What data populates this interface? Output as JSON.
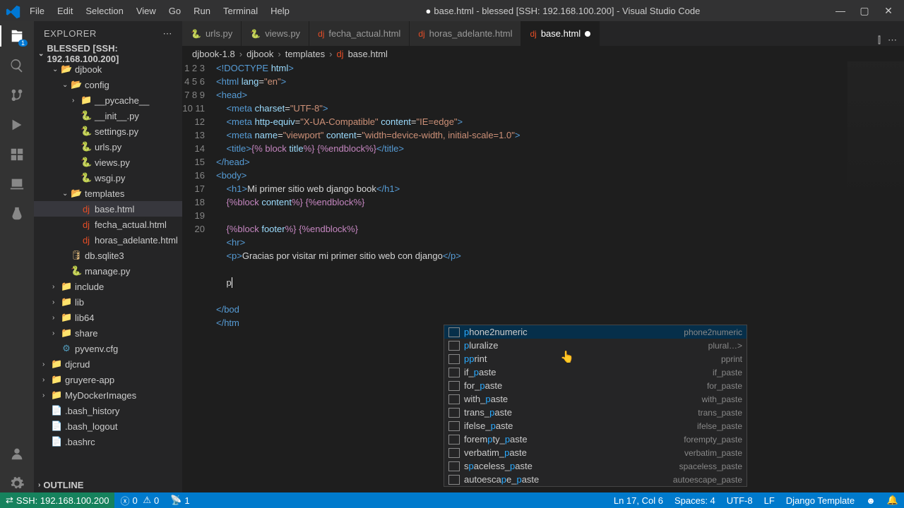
{
  "window": {
    "title": "base.html - blessed [SSH: 192.168.100.200] - Visual Studio Code"
  },
  "menu": [
    "File",
    "Edit",
    "Selection",
    "View",
    "Go",
    "Run",
    "Terminal",
    "Help"
  ],
  "explorer": {
    "title": "EXPLORER",
    "section": "BLESSED [SSH: 192.168.100.200]",
    "outline": "OUTLINE",
    "tree": [
      {
        "d": 1,
        "t": "folder-open",
        "n": "djbook"
      },
      {
        "d": 2,
        "t": "folder-open",
        "n": "config"
      },
      {
        "d": 3,
        "t": "folder",
        "n": "__pycache__"
      },
      {
        "d": 3,
        "t": "py",
        "n": "__init__.py"
      },
      {
        "d": 3,
        "t": "py",
        "n": "settings.py"
      },
      {
        "d": 3,
        "t": "py",
        "n": "urls.py"
      },
      {
        "d": 3,
        "t": "py",
        "n": "views.py"
      },
      {
        "d": 3,
        "t": "py",
        "n": "wsgi.py"
      },
      {
        "d": 2,
        "t": "folder-open",
        "n": "templates"
      },
      {
        "d": 3,
        "t": "dj",
        "n": "base.html",
        "sel": true
      },
      {
        "d": 3,
        "t": "dj",
        "n": "fecha_actual.html"
      },
      {
        "d": 3,
        "t": "dj",
        "n": "horas_adelante.html"
      },
      {
        "d": 2,
        "t": "db",
        "n": "db.sqlite3"
      },
      {
        "d": 2,
        "t": "py",
        "n": "manage.py"
      },
      {
        "d": 1,
        "t": "folder",
        "n": "include"
      },
      {
        "d": 1,
        "t": "folder",
        "n": "lib"
      },
      {
        "d": 1,
        "t": "folder",
        "n": "lib64"
      },
      {
        "d": 1,
        "t": "folder",
        "n": "share"
      },
      {
        "d": 1,
        "t": "cfg",
        "n": "pyvenv.cfg"
      },
      {
        "d": 0,
        "t": "folder",
        "n": "djcrud"
      },
      {
        "d": 0,
        "t": "folder",
        "n": "gruyere-app"
      },
      {
        "d": 0,
        "t": "folder",
        "n": "MyDockerImages"
      },
      {
        "d": 0,
        "t": "file",
        "n": ".bash_history"
      },
      {
        "d": 0,
        "t": "file",
        "n": ".bash_logout"
      },
      {
        "d": 0,
        "t": "file",
        "n": ".bashrc"
      }
    ]
  },
  "tabs": [
    {
      "icon": "py",
      "label": "urls.py"
    },
    {
      "icon": "py",
      "label": "views.py"
    },
    {
      "icon": "dj",
      "label": "fecha_actual.html"
    },
    {
      "icon": "dj",
      "label": "horas_adelante.html"
    },
    {
      "icon": "dj",
      "label": "base.html",
      "active": true,
      "dirty": true
    }
  ],
  "breadcrumb": [
    "djbook-1.8",
    "djbook",
    "templates",
    "base.html"
  ],
  "code_lines": 20,
  "suggest": {
    "items": [
      {
        "label": "phone2numeric",
        "hint": "phone2numeric",
        "sel": true
      },
      {
        "label": "pluralize",
        "hint": "plural…>"
      },
      {
        "label": "pprint",
        "hint": "pprint"
      },
      {
        "label": "if_paste",
        "hint": "if_paste"
      },
      {
        "label": "for_paste",
        "hint": "for_paste"
      },
      {
        "label": "with_paste",
        "hint": "with_paste"
      },
      {
        "label": "trans_paste",
        "hint": "trans_paste"
      },
      {
        "label": "ifelse_paste",
        "hint": "ifelse_paste"
      },
      {
        "label": "forempty_paste",
        "hint": "forempty_paste"
      },
      {
        "label": "verbatim_paste",
        "hint": "verbatim_paste"
      },
      {
        "label": "spaceless_paste",
        "hint": "spaceless_paste"
      },
      {
        "label": "autoescape_paste",
        "hint": "autoescape_paste"
      }
    ]
  },
  "status": {
    "remote": "SSH: 192.168.100.200",
    "errors": "0",
    "warnings": "0",
    "ports": "1",
    "ln_col": "Ln 17, Col 6",
    "spaces": "Spaces: 4",
    "encoding": "UTF-8",
    "eol": "LF",
    "lang": "Django Template"
  }
}
